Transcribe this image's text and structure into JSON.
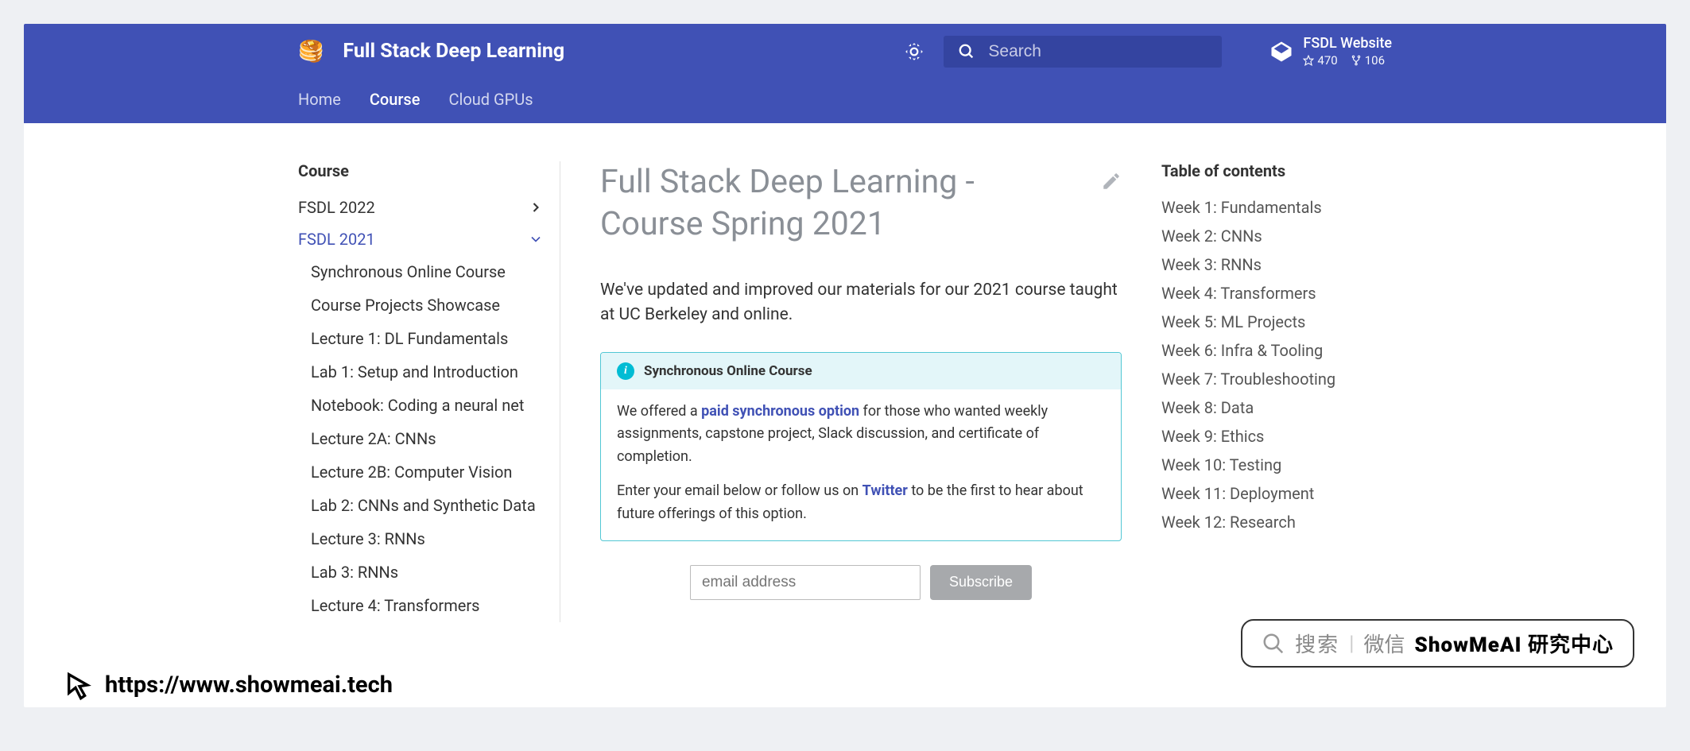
{
  "header": {
    "site_title": "Full Stack Deep Learning",
    "search_placeholder": "Search",
    "repo_name": "FSDL Website",
    "stars": "470",
    "forks": "106",
    "nav": [
      {
        "label": "Home",
        "active": false
      },
      {
        "label": "Course",
        "active": true
      },
      {
        "label": "Cloud GPUs",
        "active": false
      }
    ]
  },
  "sidebar": {
    "heading": "Course",
    "items": [
      {
        "label": "FSDL 2022",
        "expand": "right",
        "active": false,
        "children": []
      },
      {
        "label": "FSDL 2021",
        "expand": "down",
        "active": true,
        "children": [
          {
            "label": "Synchronous Online Course"
          },
          {
            "label": "Course Projects Showcase"
          },
          {
            "label": "Lecture 1: DL Fundamentals"
          },
          {
            "label": "Lab 1: Setup and Introduction"
          },
          {
            "label": "Notebook: Coding a neural net"
          },
          {
            "label": "Lecture 2A: CNNs"
          },
          {
            "label": "Lecture 2B: Computer Vision"
          },
          {
            "label": "Lab 2: CNNs and Synthetic Data"
          },
          {
            "label": "Lecture 3: RNNs"
          },
          {
            "label": "Lab 3: RNNs"
          },
          {
            "label": "Lecture 4: Transformers"
          }
        ]
      }
    ]
  },
  "article": {
    "title": "Full Stack Deep Learning - Course Spring 2021",
    "intro": "We've updated and improved our materials for our 2021 course taught at UC Berkeley and online.",
    "admonition": {
      "title": "Synchronous Online Course",
      "p1_a": "We offered a ",
      "p1_link": "paid synchronous option",
      "p1_b": " for those who wanted weekly assignments, capstone project, Slack discussion, and certificate of completion.",
      "p2_a": "Enter your email below or follow us on ",
      "p2_link": "Twitter",
      "p2_b": " to be the first to hear about future offerings of this option."
    },
    "subscribe": {
      "placeholder": "email address",
      "button": "Subscribe"
    }
  },
  "toc": {
    "heading": "Table of contents",
    "items": [
      "Week 1: Fundamentals",
      "Week 2: CNNs",
      "Week 3: RNNs",
      "Week 4: Transformers",
      "Week 5: ML Projects",
      "Week 6: Infra & Tooling",
      "Week 7: Troubleshooting",
      "Week 8: Data",
      "Week 9: Ethics",
      "Week 10: Testing",
      "Week 11: Deployment",
      "Week 12: Research"
    ]
  },
  "watermark": {
    "t1": "搜索",
    "t2": "微信",
    "bold": "ShowMeAI 研究中心"
  },
  "bottom_url": "https://www.showmeai.tech"
}
